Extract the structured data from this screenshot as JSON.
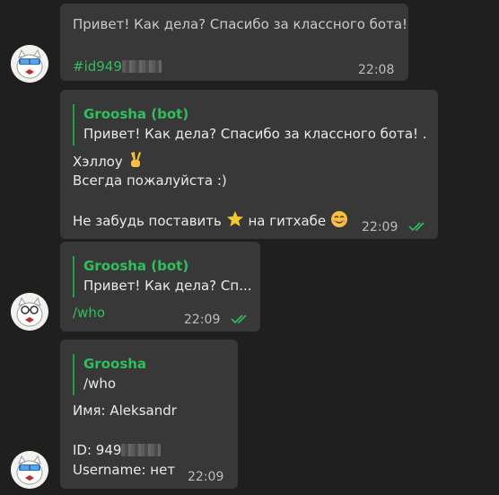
{
  "messages": [
    {
      "text_line1": "Привет! Как дела? Спасибо за классного бота!",
      "hashtag": "#id949",
      "time": "22:08"
    },
    {
      "reply_author": "Groosha (bot)",
      "reply_quote": "Привет! Как дела? Спасибо за классного бота!  ...",
      "line1": "Хэллоу",
      "line2": "Всегда пожалуйста :)",
      "line3_a": "Не забудь поставить",
      "line3_b": "на гитхабе",
      "time": "22:09"
    },
    {
      "reply_author": "Groosha (bot)",
      "reply_quote": "Привет! Как дела? Сп...",
      "command": "/who",
      "time": "22:09"
    },
    {
      "reply_author": "Groosha",
      "reply_quote": "/who",
      "name_line": "Имя: Aleksandr",
      "id_line": "ID: 949",
      "username_line": "Username: нет",
      "time": "22:09"
    }
  ],
  "icons": {
    "victory": "victory-hand-icon",
    "star": "star-icon",
    "smile": "smiling-face-icon",
    "read": "double-check-icon"
  },
  "colors": {
    "background": "#1f1f1f",
    "bubble": "#383838",
    "accent_green": "#2fbf5c"
  }
}
